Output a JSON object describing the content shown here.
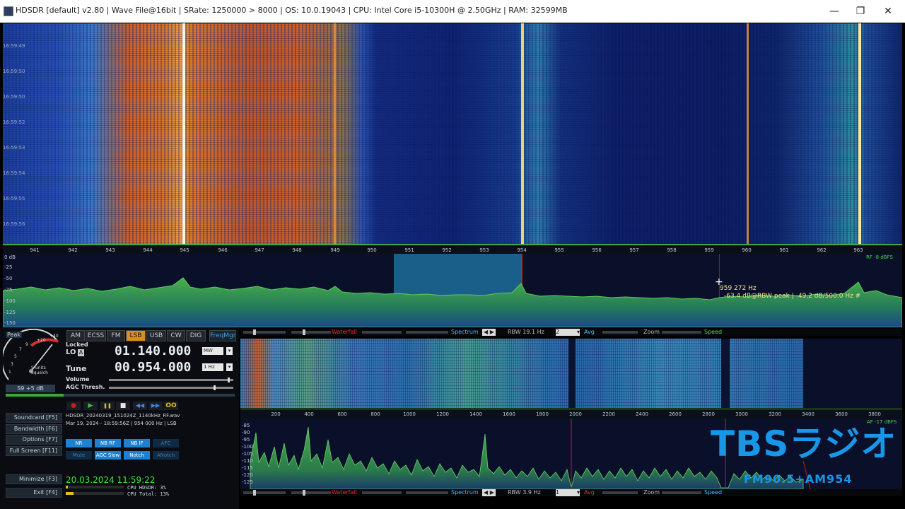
{
  "window": {
    "title": "HDSDR  [default]  v2.80   |  Wave File@16bit  |  SRate: 1250000 > 8000  |  OS: 10.0.19043  |  CPU: Intel Core i5-10300H @ 2.50GHz  |  RAM: 32599MB",
    "controls": {
      "minimize": "—",
      "restore": "❐",
      "close": "✕"
    }
  },
  "waterfall": {
    "time_labels": [
      "16:59:49",
      "16:59:50",
      "16:59:50",
      "16:59:52",
      "16:59:53",
      "16:59:54",
      "16:59:55",
      "16:59:56"
    ],
    "freq_ticks": [
      "941",
      "942",
      "943",
      "944",
      "945",
      "946",
      "947",
      "948",
      "949",
      "950",
      "951",
      "952",
      "953",
      "954",
      "955",
      "956",
      "957",
      "958",
      "959",
      "960",
      "961",
      "962",
      "963"
    ]
  },
  "spectrum": {
    "db_labels": [
      "0 dB",
      "-25",
      "-50",
      "-75",
      "-100",
      "-125",
      "-150"
    ],
    "rf_label": "RF -8 dBFS",
    "cursor_freq": "959 272 Hz",
    "cursor_level": "-63.4 dB@RBW peak  |  -49.2 dB/500.0 Hz #"
  },
  "strip1": {
    "waterfall": "Waterfall",
    "spectrum": "Spectrum",
    "rbw": "RBW 19.1 Hz",
    "avg_value": "2",
    "avg": "Avg",
    "zoom": "Zoom",
    "speed": "Speed"
  },
  "modes": [
    "AM",
    "ECSS",
    "FM",
    "LSB",
    "USB",
    "CW",
    "DIG"
  ],
  "active_mode": "LSB",
  "freqmgr": "FreqMgr",
  "smeter": {
    "peak": "Peak",
    "scale": [
      "1",
      "3",
      "5",
      "7",
      "9",
      "+20",
      "+40"
    ],
    "squelch_label_1": "S-units",
    "squelch_label_2": "Squelch",
    "reading": "S9 +5 dB"
  },
  "lo": {
    "locked": "Locked",
    "label": "LO",
    "a": "A",
    "value": "01.140.000",
    "unit": "MW"
  },
  "tune": {
    "label": "Tune",
    "value": "00.954.000",
    "unit": "1 Hz"
  },
  "volume_label": "Volume",
  "agc_label": "AGC Thresh.",
  "playback": {
    "rec": "●",
    "play": "▶",
    "pause": "❚❚",
    "stop": "■",
    "rew": "◀◀",
    "ffw": "▶▶",
    "loop": "OO"
  },
  "file": {
    "name": "HDSDR_20240319_151024Z_1140kHz_RF.wav",
    "info": "Mar 19, 2024 - 18:59:56Z  |  954 000 Hz  |  LSB"
  },
  "function_buttons": [
    "Soundcard  [F5]",
    "Bandwidth  [F6]",
    "Options  [F7]",
    "Full Screen  [F11]",
    "Minimize  [F3]",
    "Exit  [F4]"
  ],
  "dsp": {
    "row1": [
      "NR",
      "NB RF",
      "NB IF",
      "AFC"
    ],
    "row2": [
      "Mute",
      "AGC Slow",
      "Notch",
      "ANotch"
    ]
  },
  "clock": "20.03.2024 11:59:22",
  "cpu": {
    "hdsdr": "CPU HDSDR:  3%",
    "total": "CPU Total:  13%"
  },
  "strip2": {
    "waterfall": "Waterfall",
    "spectrum": "Spectrum",
    "rbw": "RBW  3.9 Hz",
    "avg_value": "1",
    "avg": "Avg",
    "zoom": "Zoom",
    "speed": "Speed"
  },
  "af": {
    "ticks": [
      "200",
      "400",
      "600",
      "800",
      "1000",
      "1200",
      "1400",
      "1600",
      "1800",
      "2000",
      "2200",
      "2400",
      "2600",
      "2800",
      "3000",
      "3200",
      "3400",
      "3600",
      "3800"
    ],
    "db_labels": [
      "-85",
      "-90",
      "-95",
      "-100",
      "-105",
      "-110",
      "-115",
      "-120",
      "-125"
    ],
    "af_label": "AF -17 dBFS"
  },
  "branding": {
    "logo": "TBSラジオ",
    "sub": "FM90.5+AM954"
  },
  "colors": {
    "accent": "#1896e8",
    "active_mode": "#d79020",
    "spectrum_green": "#3aa83a",
    "label_red": "#dd3030"
  }
}
